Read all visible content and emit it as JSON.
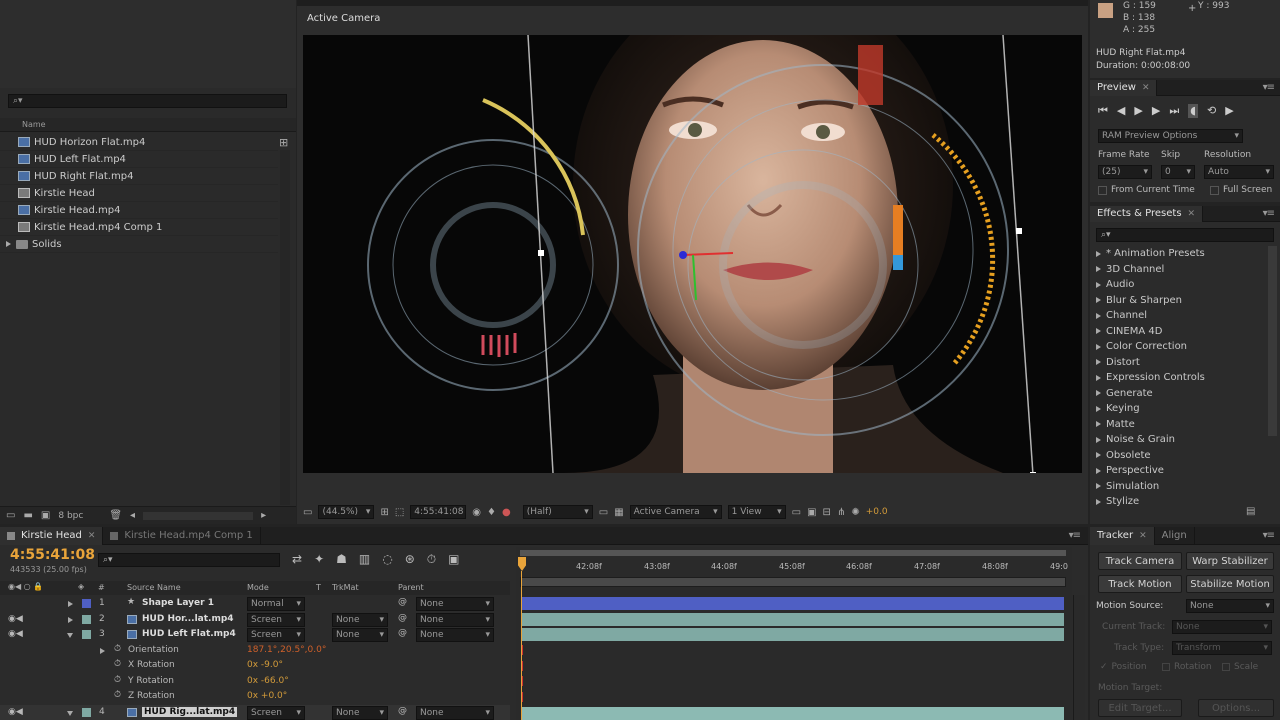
{
  "project": {
    "search_placeholder": "",
    "col_name": "Name",
    "items": [
      {
        "name": "HUD Horizon Flat.mp4",
        "type": "video"
      },
      {
        "name": "HUD Left Flat.mp4",
        "type": "video"
      },
      {
        "name": "HUD Right Flat.mp4",
        "type": "video"
      },
      {
        "name": "Kirstie Head",
        "type": "comp"
      },
      {
        "name": "Kirstie Head.mp4",
        "type": "video"
      },
      {
        "name": "Kirstie Head.mp4 Comp 1",
        "type": "comp"
      },
      {
        "name": "Solids",
        "type": "folder"
      }
    ],
    "bpc": "8 bpc"
  },
  "viewer": {
    "label": "Active Camera",
    "zoom": "(44.5%)",
    "timecode": "4:55:41:08",
    "resolution": "(Half)",
    "camera": "Active Camera",
    "views": "1 View",
    "exposure": "+0.0"
  },
  "info": {
    "g": "G : 159",
    "b": "B : 138",
    "a": "A : 255",
    "y": "Y : 993",
    "swatch": "#c9a183",
    "file": "HUD Right Flat.mp4",
    "duration": "Duration: 0:00:08:00"
  },
  "preview": {
    "title": "Preview",
    "ram_options": "RAM Preview Options",
    "frame_rate_label": "Frame Rate",
    "skip_label": "Skip",
    "resolution_label": "Resolution",
    "frame_rate": "(25)",
    "skip": "0",
    "resolution": "Auto",
    "from_current": "From Current Time",
    "full_screen": "Full Screen"
  },
  "effects": {
    "title": "Effects & Presets",
    "items": [
      "* Animation Presets",
      "3D Channel",
      "Audio",
      "Blur & Sharpen",
      "Channel",
      "CINEMA 4D",
      "Color Correction",
      "Distort",
      "Expression Controls",
      "Generate",
      "Keying",
      "Matte",
      "Noise & Grain",
      "Obsolete",
      "Perspective",
      "Simulation",
      "Stylize"
    ]
  },
  "timeline": {
    "tab_active": "Kirstie Head",
    "tab_other": "Kirstie Head.mp4 Comp 1",
    "timecode": "4:55:41:08",
    "frame_info": "443533 (25.00 fps)",
    "col_hash": "#",
    "col_source": "Source Name",
    "col_mode": "Mode",
    "col_t": "T",
    "col_trkmat": "TrkMat",
    "col_parent": "Parent",
    "ruler": [
      "42:08f",
      "43:08f",
      "44:08f",
      "45:08f",
      "46:08f",
      "47:08f",
      "48:08f",
      "49:0"
    ],
    "layers": [
      {
        "num": "1",
        "name": "Shape Layer 1",
        "mode": "Normal",
        "trkmat": "",
        "parent": "None",
        "bar": "#4f5fc4"
      },
      {
        "num": "2",
        "name": "HUD Hor...lat.mp4",
        "mode": "Screen",
        "trkmat": "None",
        "parent": "None",
        "bar": "#7fa9a3"
      },
      {
        "num": "3",
        "name": "HUD Left Flat.mp4",
        "mode": "Screen",
        "trkmat": "None",
        "parent": "None",
        "bar": "#7fa9a3"
      }
    ],
    "props": [
      {
        "name": "Orientation",
        "value": "187.1°,20.5°,0.0°"
      },
      {
        "name": "X Rotation",
        "value": "0x -9.0°"
      },
      {
        "name": "Y Rotation",
        "value": "0x -66.0°"
      },
      {
        "name": "Z Rotation",
        "value": "0x +0.0°"
      }
    ],
    "layer4": {
      "num": "4",
      "name": "HUD Rig...lat.mp4",
      "mode": "Screen",
      "trkmat": "None",
      "parent": "None"
    }
  },
  "tracker": {
    "tab_active": "Tracker",
    "tab_other": "Align",
    "track_camera": "Track Camera",
    "warp_stabilizer": "Warp Stabilizer",
    "track_motion": "Track Motion",
    "stabilize_motion": "Stabilize Motion",
    "motion_source_label": "Motion Source:",
    "motion_source": "None",
    "current_track_label": "Current Track:",
    "current_track": "None",
    "track_type_label": "Track Type:",
    "track_type": "Transform",
    "position": "Position",
    "rotation": "Rotation",
    "scale": "Scale",
    "motion_target": "Motion Target:",
    "edit_target": "Edit Target...",
    "options": "Options..."
  }
}
